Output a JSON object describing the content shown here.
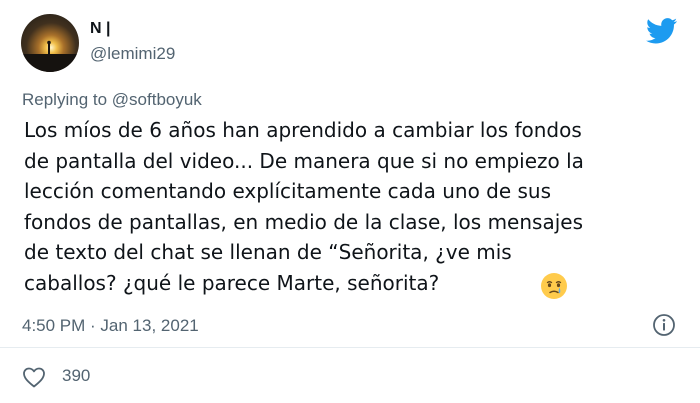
{
  "author": {
    "display_name": "N |",
    "username": "@lemimi29"
  },
  "reply": {
    "prefix": "Replying to ",
    "mention": "@softboyuk"
  },
  "tweet": {
    "lines": [
      "Los míos de 6 años han aprendido a cambiar los fondos",
      "de pantalla del video... De manera que si no empiezo la",
      "lección comentando explícitamente cada uno de sus",
      "fondos de pantallas, en medio de la clase, los mensajes",
      "de texto del chat se llenan de “Señorita, ¿ve mis",
      "caballos? ¿qué le parece Marte, señorita?"
    ],
    "emoji": "face-holding-back-tears"
  },
  "meta": {
    "timestamp": "4:50 PM · Jan 13, 2021"
  },
  "engagement": {
    "likes": "390"
  },
  "colors": {
    "twitter_blue": "#1d9bf0",
    "secondary_text": "#536471",
    "primary_text": "#0f1419"
  },
  "icons": [
    "twitter-bird-icon",
    "info-icon",
    "heart-icon"
  ]
}
